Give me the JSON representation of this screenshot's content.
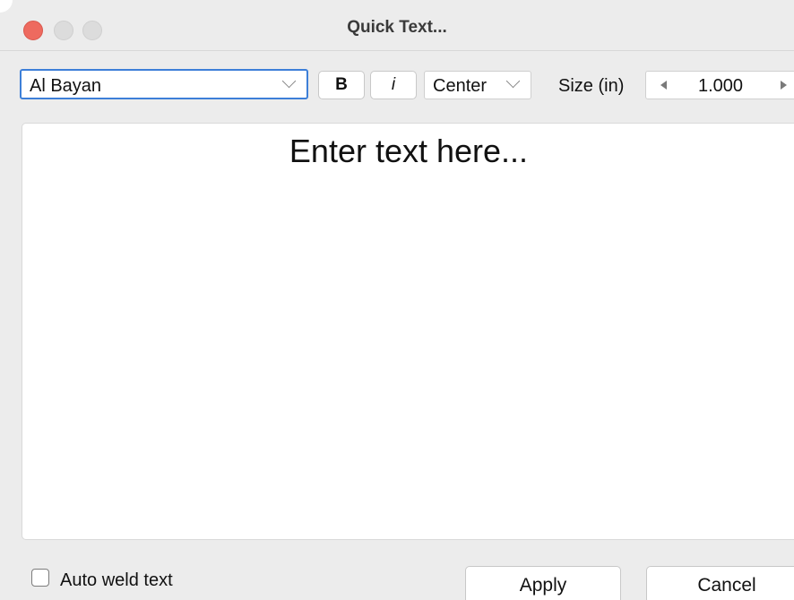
{
  "window": {
    "title": "Quick Text..."
  },
  "toolbar": {
    "font": "Al Bayan",
    "bold_label": "B",
    "italic_label": "i",
    "alignment": "Center",
    "size_label": "Size (in)",
    "size_value": "1.000"
  },
  "editor": {
    "placeholder": "Enter text here..."
  },
  "footer": {
    "auto_weld_label": "Auto weld text",
    "auto_weld_checked": false,
    "apply_label": "Apply",
    "cancel_label": "Cancel"
  },
  "colors": {
    "close_button": "#ee6a5f",
    "focus_ring": "#3d7fd8",
    "window_background": "#ececec"
  }
}
